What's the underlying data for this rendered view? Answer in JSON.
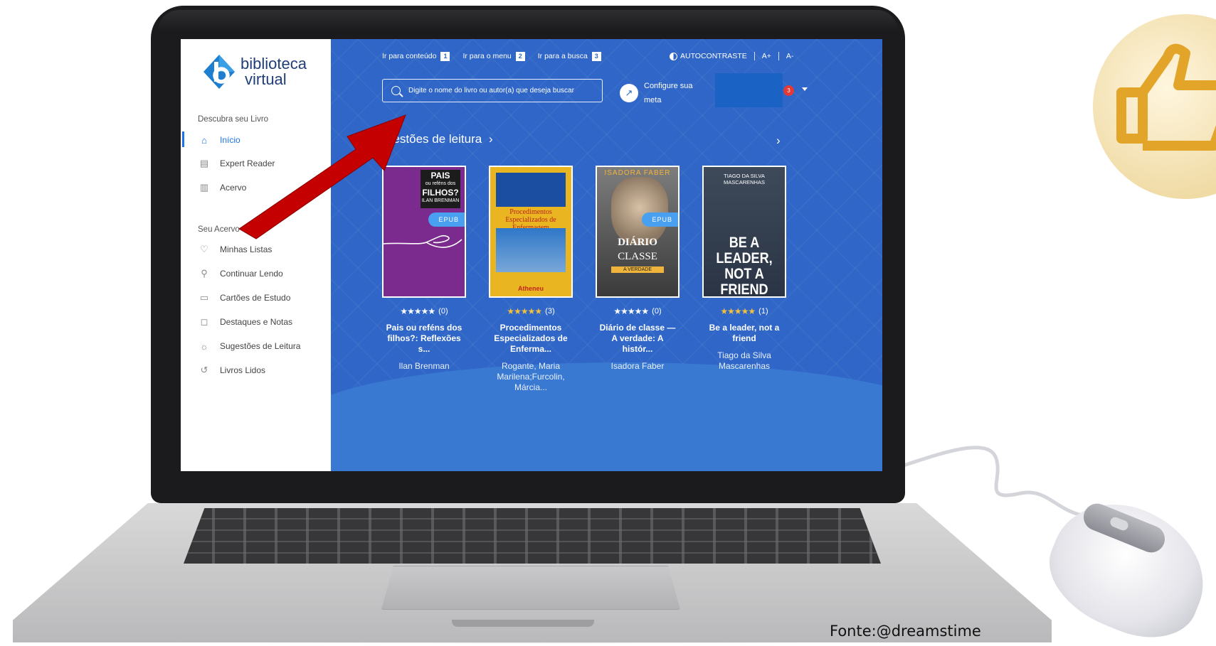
{
  "sidebar": {
    "logo_line1": "biblioteca",
    "logo_line2": "virtual",
    "section1": "Descubra seu Livro",
    "section2": "Seu Acervo",
    "items": [
      {
        "label": "Início",
        "icon": "home-icon"
      },
      {
        "label": "Expert Reader",
        "icon": "document-icon"
      },
      {
        "label": "Acervo",
        "icon": "books-icon"
      },
      {
        "label": "Minhas Listas",
        "icon": "heart-icon"
      },
      {
        "label": "Continuar Lendo",
        "icon": "reading-icon"
      },
      {
        "label": "Cartões de Estudo",
        "icon": "card-icon"
      },
      {
        "label": "Destaques e Notas",
        "icon": "note-icon"
      },
      {
        "label": "Sugestões de Leitura",
        "icon": "lightbulb-icon"
      },
      {
        "label": "Livros Lidos",
        "icon": "history-icon"
      }
    ]
  },
  "topbar": {
    "skip_content": "Ir para conteúdo",
    "skip_content_key": "1",
    "skip_menu": "Ir para o menu",
    "skip_menu_key": "2",
    "skip_search": "Ir para a busca",
    "skip_search_key": "3",
    "contrast": "AUTOCONTRASTE",
    "font_up": "A+",
    "font_down": "A-"
  },
  "search": {
    "placeholder": "Digite o nome do livro ou autor(a) que deseja buscar"
  },
  "goal": {
    "line1": "Configure sua",
    "line2": "meta"
  },
  "notifications": {
    "count": "3"
  },
  "suggestions": {
    "title": "gestões de leitura",
    "books": [
      {
        "cover_title": "PAIS",
        "cover_sub": "ou reféns dos",
        "cover_title2": "FILHOS?",
        "cover_author": "ILAN BRENMAN",
        "epub": "EPUB",
        "stars": "★★★★★",
        "count": "(0)",
        "title": "Pais ou reféns dos filhos?: Reflexões s...",
        "author": "Ilan Brenman"
      },
      {
        "cover_text": "Procedimentos Especializados de Enfermagem",
        "publisher": "Atheneu",
        "stars": "★★★★★",
        "count": "(3)",
        "title": "Procedimentos Especializados de Enferma...",
        "author": "Rogante, Maria Marilena;Furcolin, Márcia..."
      },
      {
        "cover_top": "ISADORA FABER",
        "cover_title": "DIÁRIO",
        "cover_title2": "CLASSE",
        "cover_tag": "A VERDADE",
        "epub": "EPUB",
        "stars": "★★★★★",
        "count": "(0)",
        "title": "Diário de classe — A verdade: A histór...",
        "author": "Isadora Faber"
      },
      {
        "cover_top": "TIAGO DA SILVA MASCARENHAS",
        "cover_title": "BE A LEADER, NOT A FRIEND",
        "stars": "★★★★★",
        "count": "(1)",
        "title": "Be a leader, not a friend",
        "author": "Tiago da Silva Mascarenhas"
      }
    ]
  },
  "credit": "Fonte:@dreamstime",
  "colors": {
    "main_bg": "#2f66c7",
    "accent": "#1a73e8",
    "arrow": "#c40000",
    "stars_gold": "#f4c13a"
  }
}
